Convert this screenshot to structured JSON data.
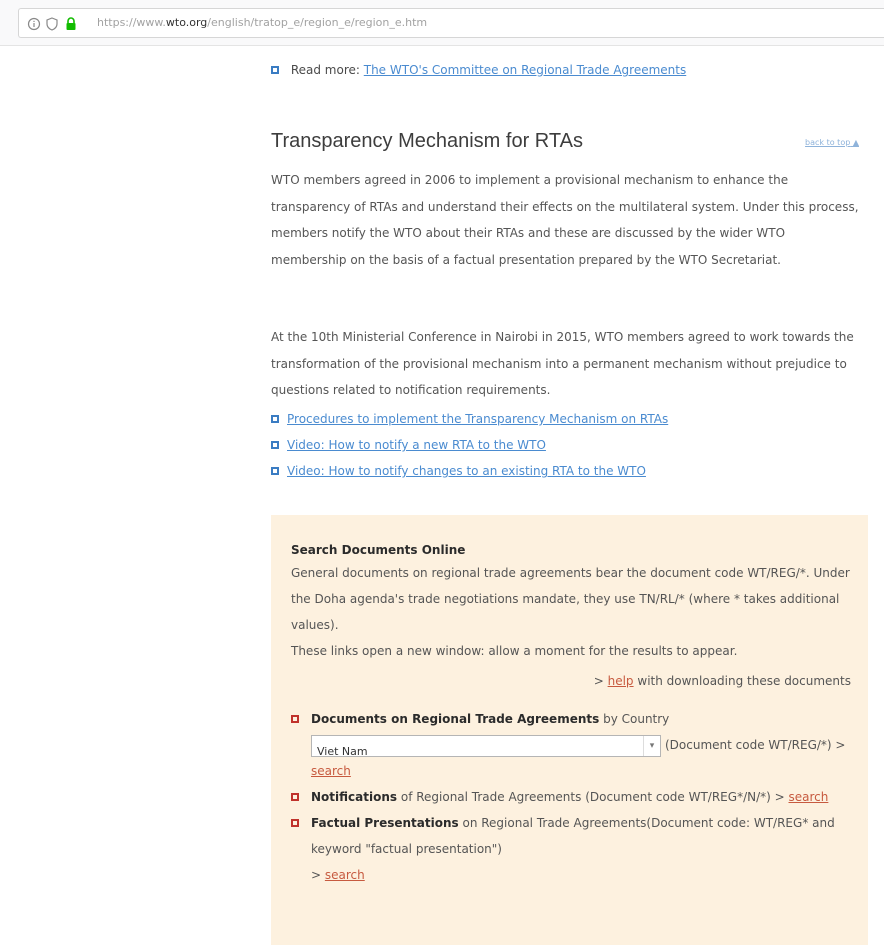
{
  "browser": {
    "url_prefix": "https://www.",
    "url_domain": "wto.org",
    "url_path": "/english/tratop_e/region_e/region_e.htm"
  },
  "readmore": {
    "label": "Read more:",
    "link": "The WTO's Committee on Regional Trade Agreements"
  },
  "section": {
    "title": "Transparency Mechanism for RTAs",
    "back_to_top": "back to top",
    "para1": "WTO members agreed in 2006 to implement a provisional mechanism to enhance the transparency of RTAs and understand their effects on the multilateral system. Under this process, members notify the WTO about their RTAs and these are discussed by the wider WTO membership on the basis of a factual presentation prepared by the WTO Secretariat.",
    "para2": "At the 10th Ministerial Conference in Nairobi in 2015, WTO members agreed to work towards the transformation of the provisional mechanism into a permanent mechanism without prejudice to questions related to notification requirements.",
    "links": [
      "Procedures to implement the Transparency Mechanism on RTAs",
      "Video: How to notify a new RTA to the WTO",
      "Video: How to notify changes to an existing RTA to the WTO"
    ]
  },
  "search_panel": {
    "title": "Search Documents Online",
    "text1": "General documents on regional trade agreements bear the document code WT/REG/*. Under the Doha agenda's trade negotiations mandate, they use TN/RL/* (where * takes additional values).",
    "text2": "These links open a new window: allow a moment for the results to appear.",
    "help_prefix": "> ",
    "help_link": "help",
    "help_suffix": " with downloading these documents",
    "items": {
      "rta_bold": "Documents on Regional Trade Agreements",
      "rta_rest": " by Country",
      "select_value": "Viet Nam",
      "rta_code": "(Document code WT/REG/*)",
      "search_prefix": " > ",
      "search_label": "search",
      "notif_bold": "Notifications",
      "notif_rest": " of Regional Trade Agreements (Document code WT/REG*/N/*)",
      "fact_bold": "Factual Presentations",
      "fact_rest": " on Regional Trade Agreements(Document code: WT/REG* and keyword \"factual presentation\")",
      "fact_search_prefix": "> "
    }
  }
}
